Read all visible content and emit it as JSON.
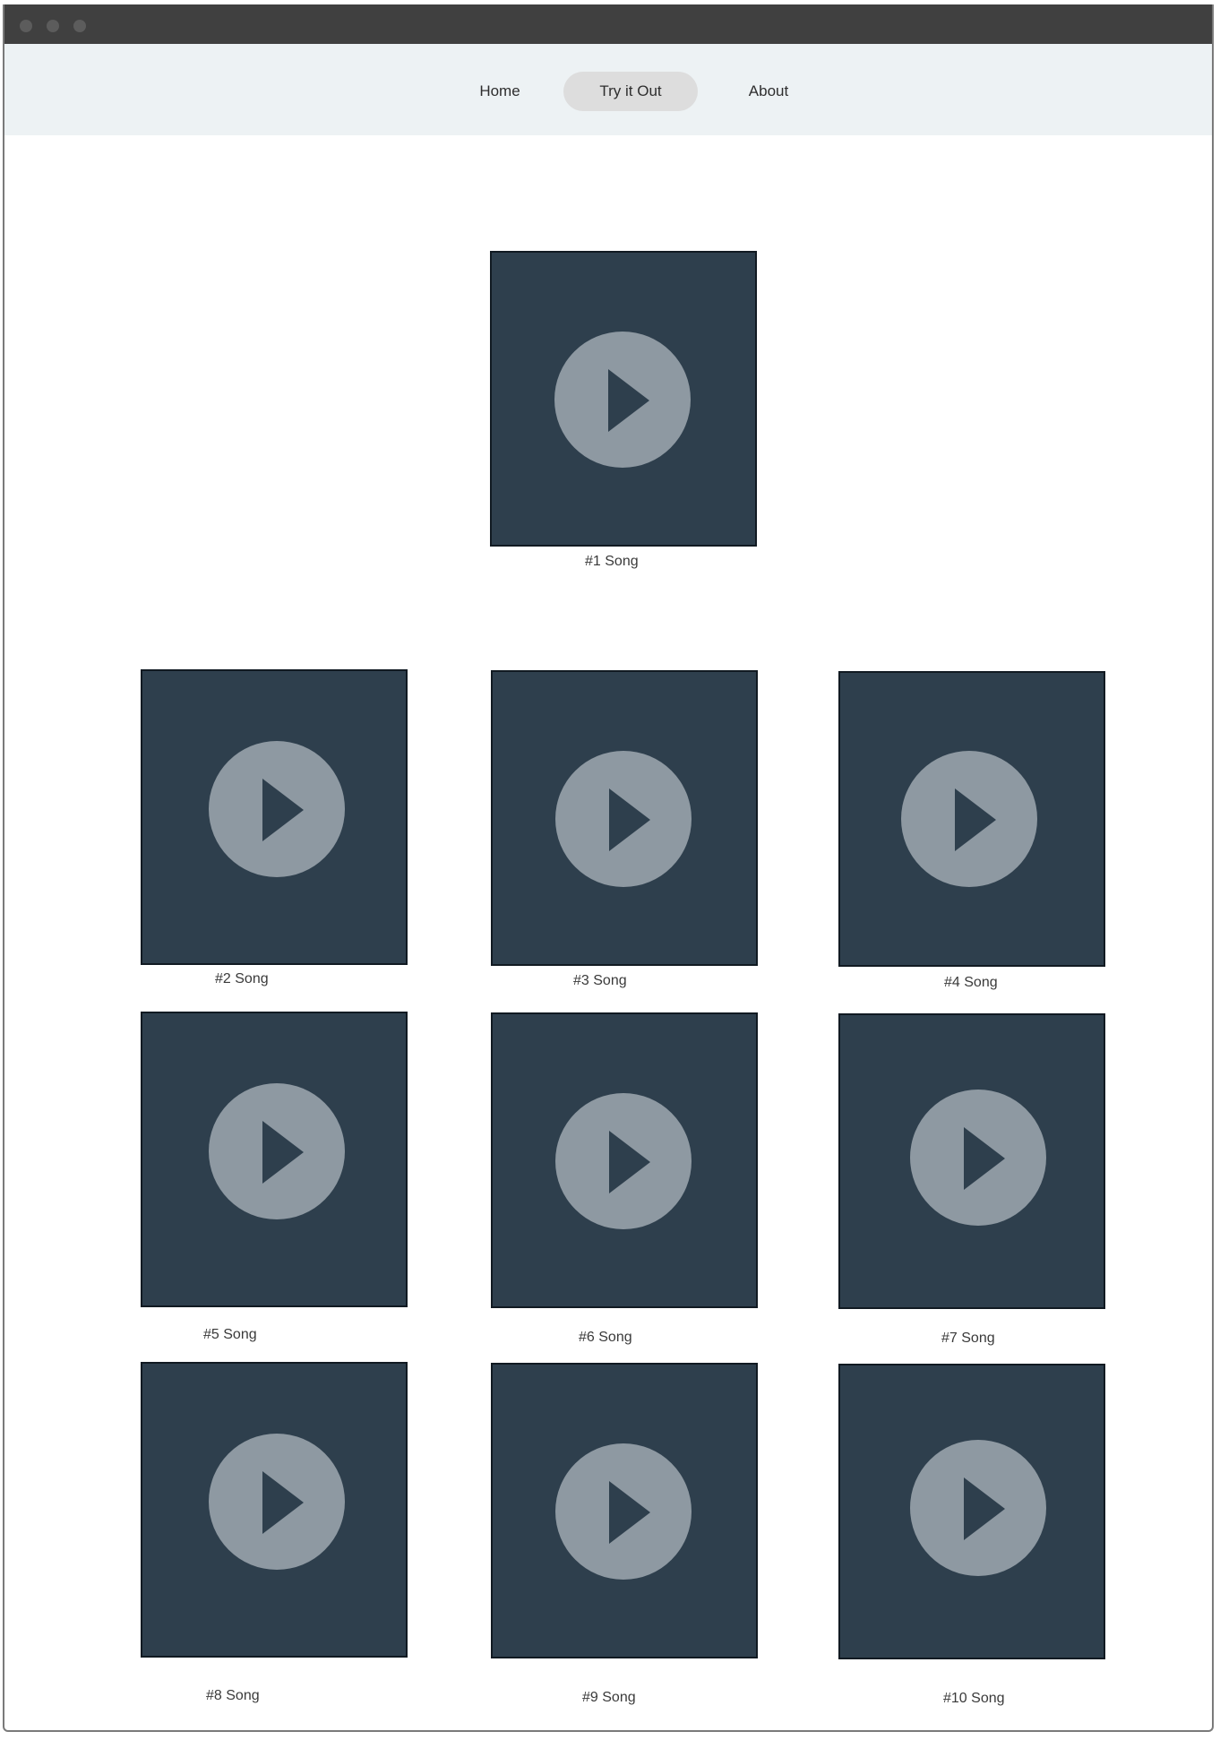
{
  "nav": {
    "items": [
      {
        "label": "Home"
      },
      {
        "label": "Try it Out",
        "active": true
      },
      {
        "label": "About"
      }
    ]
  },
  "icons": {
    "play": "play-icon"
  },
  "colors": {
    "card_bg": "#2e3f4d",
    "play_circle": "#8e99a2",
    "nav_bg": "#edf2f4",
    "nav_active_bg": "#dddddd",
    "titlebar": "#404040"
  },
  "songs": [
    {
      "label": "#1 Song"
    },
    {
      "label": "#2 Song"
    },
    {
      "label": "#3 Song"
    },
    {
      "label": "#4 Song"
    },
    {
      "label": "#5 Song"
    },
    {
      "label": "#6 Song"
    },
    {
      "label": "#7 Song"
    },
    {
      "label": "#8 Song"
    },
    {
      "label": "#9 Song"
    },
    {
      "label": "#10 Song"
    }
  ]
}
